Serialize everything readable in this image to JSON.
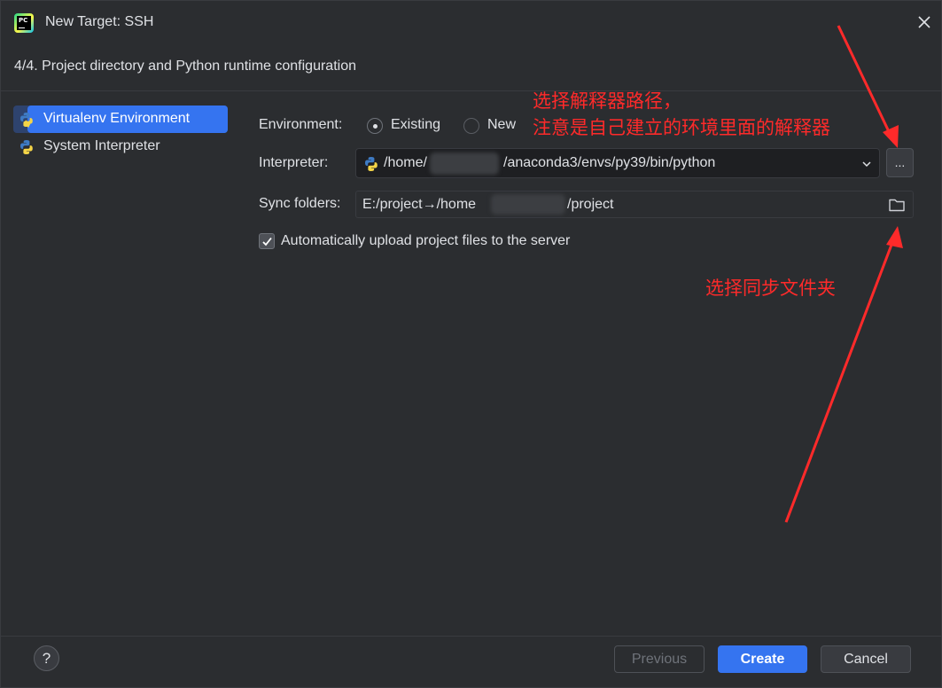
{
  "window": {
    "title": "New Target: SSH",
    "app_icon_text": "PC",
    "close_icon": "close-icon"
  },
  "step": {
    "subtitle": "4/4. Project directory and Python runtime configuration"
  },
  "sidebar": {
    "items": [
      {
        "label": "Virtualenv Environment",
        "icon": "python-virtualenv-icon",
        "selected": true
      },
      {
        "label": "System Interpreter",
        "icon": "python-icon",
        "selected": false
      }
    ]
  },
  "form": {
    "environment_label": "Environment:",
    "environment_options": [
      {
        "label": "Existing",
        "checked": true
      },
      {
        "label": "New",
        "checked": false
      }
    ],
    "interpreter_label": "Interpreter:",
    "interpreter_prefix": "/home/",
    "interpreter_suffix": "/anaconda3/envs/py39/bin/python",
    "browse_label": "...",
    "sync_label": "Sync folders:",
    "sync_prefix": "E:/project→/home",
    "sync_suffix": "/project",
    "auto_upload_label": "Automatically upload project files to the server",
    "auto_upload_checked": true
  },
  "annotations": {
    "interpreter_note_line1": "选择解释器路径，",
    "interpreter_note_line2": "注意是自己建立的环境里面的解释器",
    "sync_note": "选择同步文件夹",
    "color": "#ff2a2a"
  },
  "footer": {
    "help_label": "?",
    "previous_label": "Previous",
    "create_label": "Create",
    "cancel_label": "Cancel"
  },
  "colors": {
    "accent": "#3574f0",
    "background": "#2b2d30",
    "field_background": "#1e1f22"
  }
}
